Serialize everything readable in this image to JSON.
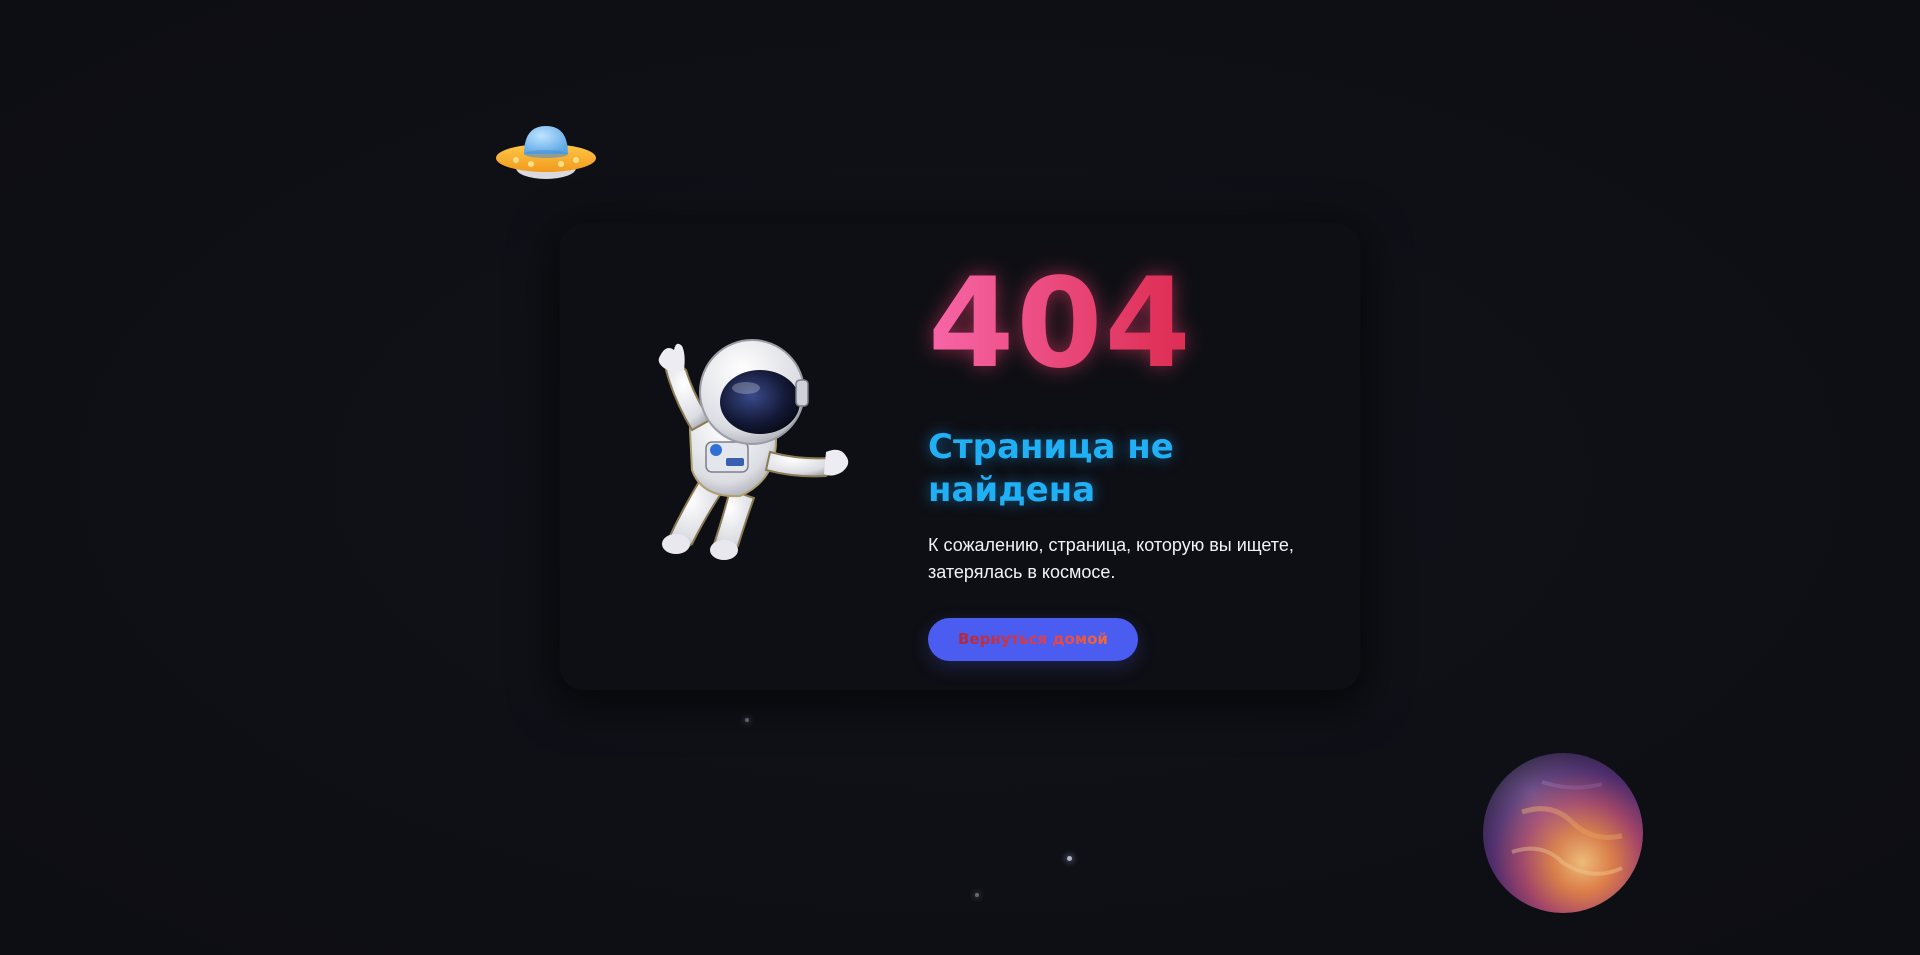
{
  "error": {
    "code": "404",
    "title": "Страница не найдена",
    "description": "К сожалению, страница, которую вы ищете, затерялась в космосе.",
    "home_button_label": "Вернуться домой"
  },
  "decor": {
    "ufo": "ufo-icon",
    "astronaut": "astronaut-illustration",
    "planet": "planet-illustration"
  },
  "colors": {
    "background": "#0f1016",
    "code_gradient_start": "#f766a8",
    "code_gradient_end": "#cf1e32",
    "title": "#1fb0f5",
    "button": "#4a5df0"
  }
}
